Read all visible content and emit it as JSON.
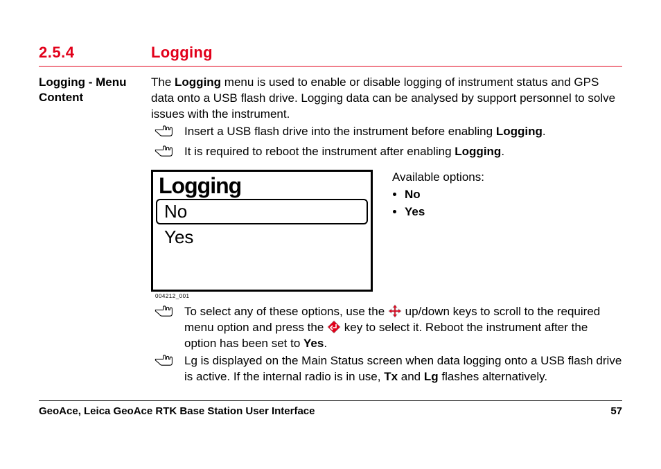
{
  "section": {
    "number": "2.5.4",
    "title": "Logging"
  },
  "sidebar": {
    "label_line1": "Logging - Menu",
    "label_line2": "Content"
  },
  "intro": {
    "part1": "The ",
    "bold1": "Logging",
    "part2": " menu is used to enable or disable logging of instrument status and GPS data onto a USB flash drive. Logging data can be analysed by support personnel to solve issues with the instrument."
  },
  "notes_top": [
    {
      "pre": "Insert a USB flash drive into the instrument before enabling ",
      "bold": "Logging",
      "post": "."
    },
    {
      "pre": "It is required to reboot the instrument after enabling ",
      "bold": "Logging",
      "post": "."
    }
  ],
  "lcd": {
    "title": "Logging",
    "items": [
      {
        "label": "No",
        "selected": true
      },
      {
        "label": "Yes",
        "selected": false
      }
    ],
    "caption": "004212_001"
  },
  "available": {
    "heading": "Available options:",
    "options": [
      "No",
      "Yes"
    ]
  },
  "notes_bottom": [
    {
      "parts": [
        {
          "t": "text",
          "v": "To select any of these options, use the "
        },
        {
          "t": "nav_icon"
        },
        {
          "t": "text",
          "v": " up/down keys to scroll to the required menu option and press the "
        },
        {
          "t": "enter_icon"
        },
        {
          "t": "text",
          "v": " key to select it. Reboot the instrument after the option has been set to "
        },
        {
          "t": "bold",
          "v": "Yes"
        },
        {
          "t": "text",
          "v": "."
        }
      ]
    },
    {
      "parts": [
        {
          "t": "text",
          "v": "Lg is displayed on the Main Status screen when data logging onto a USB flash drive is active. If the internal radio is in use, "
        },
        {
          "t": "bold",
          "v": "Tx"
        },
        {
          "t": "text",
          "v": " and "
        },
        {
          "t": "bold",
          "v": "Lg"
        },
        {
          "t": "text",
          "v": " flashes alternatively."
        }
      ]
    }
  ],
  "footer": {
    "left": "GeoAce, Leica GeoAce RTK Base Station User Interface",
    "right": "57"
  }
}
